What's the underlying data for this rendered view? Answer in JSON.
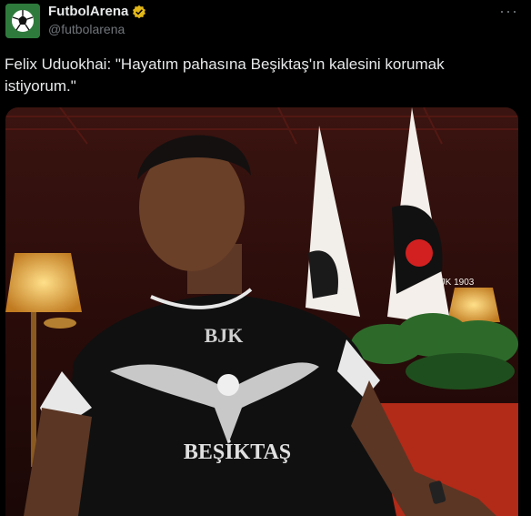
{
  "tweet": {
    "display_name": "FutbolArena",
    "handle": "@futbolarena",
    "more_glyph": "···",
    "text": "Felix Uduokhai: \"Hayatım pahasına Beşiktaş'ın kalesini korumak istiyorum.\"",
    "verified": true,
    "avatar_icon": "soccer-ball-icon"
  },
  "media": {
    "shirt_top_text": "BJK",
    "shirt_bottom_text": "BEŞİKTAŞ",
    "flag_text": "BJK 1903"
  },
  "colors": {
    "background": "#000000",
    "text": "#e7e9ea",
    "secondary": "#71767b",
    "verified_badge": "#e2b719"
  }
}
